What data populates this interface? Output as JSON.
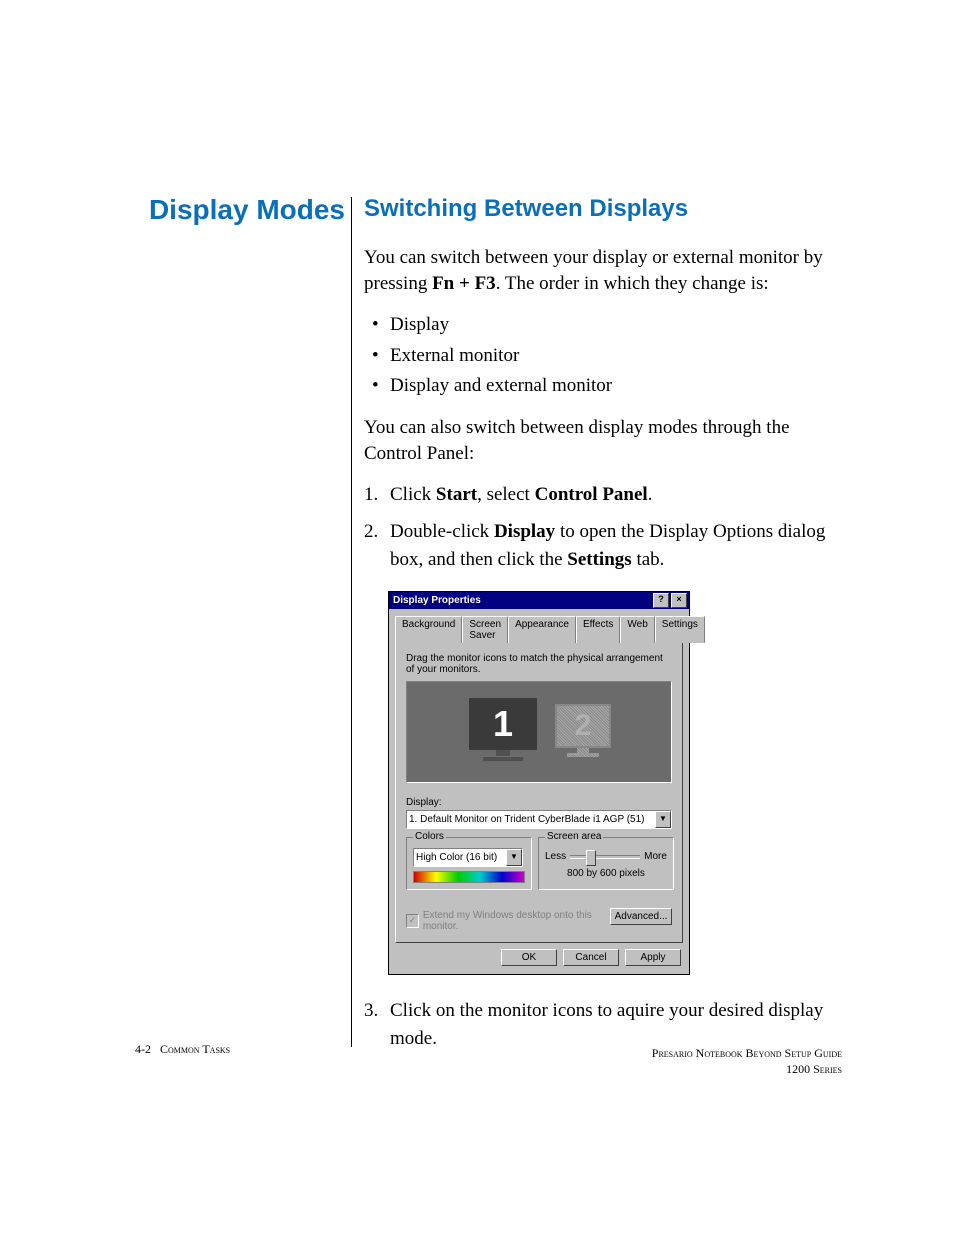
{
  "side_heading": "Display Modes",
  "section_heading": "Switching Between Displays",
  "intro_a": "You can switch between your display or external monitor by pressing ",
  "intro_key": "Fn + F3",
  "intro_b": ". The order in which they change is:",
  "bullets": [
    "Display",
    "External monitor",
    "Display and external monitor"
  ],
  "para2": "You can also switch between display modes through the Control Panel:",
  "step1_a": "Click ",
  "step1_b": "Start",
  "step1_c": ", select ",
  "step1_d": "Control Panel",
  "step1_e": ".",
  "step2_a": "Double-click ",
  "step2_b": "Display",
  "step2_c": " to open the Display Options dialog box, and then click the ",
  "step2_d": "Settings",
  "step2_e": " tab.",
  "step3": "Click on the monitor icons to aquire your desired display mode.",
  "dialog": {
    "title": "Display Properties",
    "help": "?",
    "close": "×",
    "tabs": [
      "Background",
      "Screen Saver",
      "Appearance",
      "Effects",
      "Web",
      "Settings"
    ],
    "active_tab": "Settings",
    "instruction": "Drag the monitor icons to match the physical arrangement of your monitors.",
    "monitor1": "1",
    "monitor2": "2",
    "display_label": "Display:",
    "display_value": "1. Default Monitor on Trident CyberBlade i1 AGP (51)",
    "colors_label": "Colors",
    "colors_value": "High Color (16 bit)",
    "area_label": "Screen area",
    "less": "Less",
    "more": "More",
    "resolution": "800 by 600 pixels",
    "extend": "Extend my Windows desktop onto this monitor.",
    "advanced": "Advanced...",
    "ok": "OK",
    "cancel": "Cancel",
    "apply": "Apply"
  },
  "footer_left_page": "4-2",
  "footer_left_text": "Common Tasks",
  "footer_right_1": "Presario Notebook Beyond Setup Guide",
  "footer_right_2": "1200 Series"
}
